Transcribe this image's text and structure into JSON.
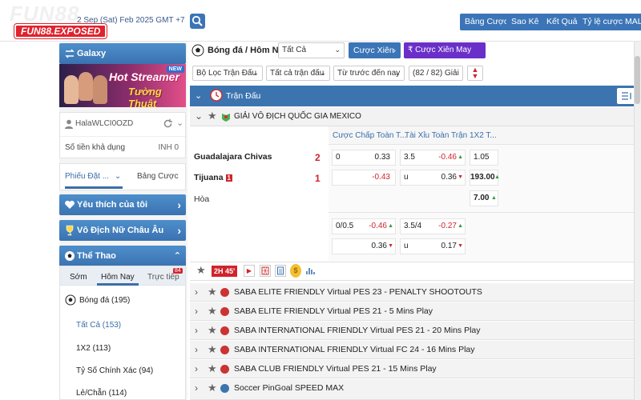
{
  "header": {
    "logo_text": "FUN88.EXPOSED",
    "logo_ghost": "FUN88",
    "datetime": "2 Sep (Sat) Feb 2025 GMT +7",
    "buttons": [
      "Bảng Cược",
      "Sao Kê",
      "Kết Quả",
      "Tỷ lệ cược MALAY"
    ]
  },
  "sidebar": {
    "galaxy_label": "Galaxy",
    "banner_line1": "Hot Streamer",
    "banner_line2": "Tường Thuật",
    "banner_badge": "NEW",
    "username": "HalaWLCI0OZD",
    "balance_label": "Số tiền khả dụng",
    "balance_value": "INH 0",
    "tab_betslip": "Phiếu Đặt ...",
    "tab_betlist": "Bảng Cược",
    "favorites": "Yêu thích của tôi",
    "womens_champ": "Vô Địch Nữ Châu Âu",
    "sports": "Thể Thao",
    "sub_tabs": [
      "Sớm",
      "Hôm Nay",
      "Trực tiếp"
    ],
    "live_count": "84",
    "football": "Bóng đá",
    "football_count": "(195)",
    "bet_types": [
      {
        "label": "Tất Cả",
        "count": "(153)"
      },
      {
        "label": "1X2",
        "count": "(113)"
      },
      {
        "label": "Tỷ Số Chính Xác",
        "count": "(94)"
      },
      {
        "label": "Lẻ/Chẵn",
        "count": "(114)"
      }
    ]
  },
  "main": {
    "breadcrumb": "Bóng đá / Hôm Nay",
    "filter_all": "Tất Cả",
    "btn_parlay": "Cược Xiên",
    "btn_lucky": "Cược Xiên May Mắn",
    "filter_leagues": "Bộ Lọc Trận Đấu",
    "filter_markets": "Tất cả trận đấu",
    "filter_sort": "Từ trước đến nay",
    "league_count": "(82 / 82) Giải",
    "match_section": "Trận Đấu",
    "league": "GIẢI VÔ ĐỊCH QUỐC GIA MEXICO",
    "col_handicap": "Cược Chấp Toàn T...",
    "col_ou": "Tài Xỉu Toàn Trận",
    "col_1x2": "1X2 T...",
    "home_team": "Guadalajara Chivas",
    "away_team": "Tijuana",
    "away_card": "1",
    "home_score": "2",
    "away_score": "1",
    "draw": "Hòa",
    "row1": {
      "hdp_line": "0",
      "hdp_home": "0.33",
      "ou_line": "3.5",
      "ou_over": "-0.46",
      "x12_home": "1.05"
    },
    "row2": {
      "hdp_away": "-0.43",
      "ou_label": "u",
      "ou_under": "0.36",
      "x12_away": "193.00"
    },
    "row3": {
      "x12_draw": "7.00"
    },
    "row4": {
      "hdp_line": "0/0.5",
      "hdp_home": "-0.46",
      "ou_line": "3.5/4",
      "ou_over": "-0.27"
    },
    "row5": {
      "hdp_away": "0.36",
      "ou_label": "u",
      "ou_under": "0.17"
    },
    "match_time": "2H 45'",
    "leagues": [
      "SABA ELITE FRIENDLY Virtual PES 23 - PENALTY SHOOTOUTS",
      "SABA ELITE FRIENDLY Virtual PES 21 - 5 Mins Play",
      "SABA INTERNATIONAL FRIENDLY Virtual PES 21 - 20 Mins Play",
      "SABA INTERNATIONAL FRIENDLY Virtual FC 24 - 16 Mins Play",
      "SABA CLUB FRIENDLY Virtual PES 21 - 15 Mins Play",
      "Soccer PinGoal SPEED MAX"
    ]
  }
}
